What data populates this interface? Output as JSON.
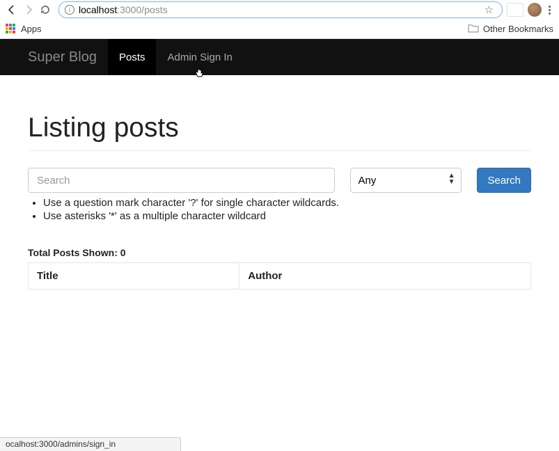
{
  "browser": {
    "url_proto_host": "localhost",
    "url_port_path": ":3000/posts",
    "apps_label": "Apps",
    "other_bookmarks": "Other Bookmarks",
    "status_url": "ocalhost:3000/admins/sign_in"
  },
  "navbar": {
    "brand": "Super Blog",
    "items": [
      {
        "label": "Posts",
        "active": true
      },
      {
        "label": "Admin Sign In",
        "active": false
      }
    ]
  },
  "page": {
    "title": "Listing posts",
    "search_placeholder": "Search",
    "select_option": "Any",
    "search_button": "Search",
    "hints": [
      "Use a question mark character '?' for single character wildcards.",
      "Use asterisks '*' as a multiple character wildcard"
    ],
    "total_label": "Total Posts Shown:",
    "total_count": "0",
    "columns": [
      "Title",
      "Author"
    ]
  }
}
